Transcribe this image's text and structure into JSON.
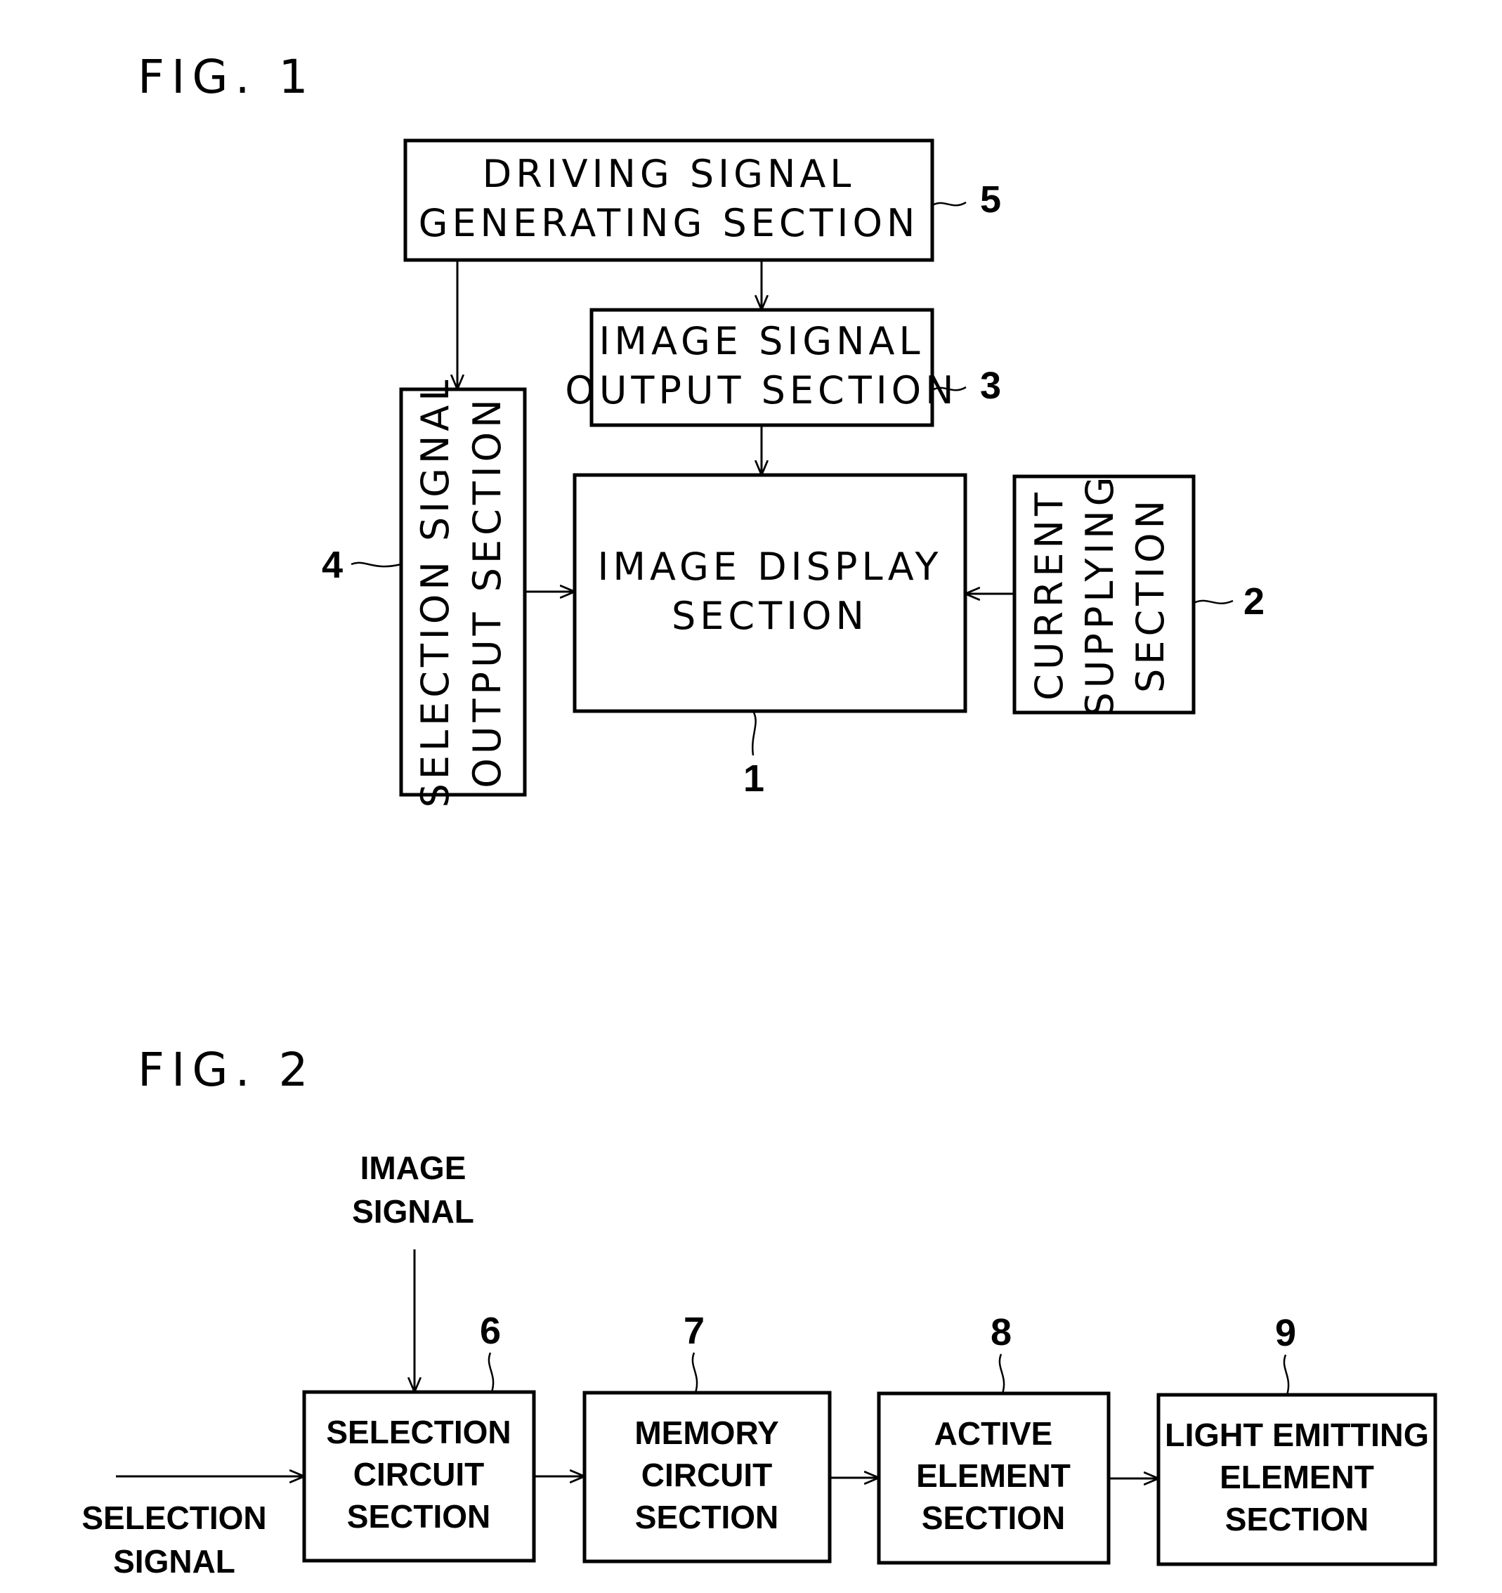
{
  "figures": [
    {
      "title": "FIG. 1",
      "blocks": {
        "driving_signal": {
          "ref": "5",
          "lines": [
            "DRIVING SIGNAL",
            "GENERATING SECTION"
          ]
        },
        "image_signal_output": {
          "ref": "3",
          "lines": [
            "IMAGE SIGNAL",
            "OUTPUT SECTION"
          ]
        },
        "selection_signal_output": {
          "ref": "4",
          "lines": [
            "SELECTION SIGNAL",
            "OUTPUT SECTION"
          ]
        },
        "image_display": {
          "ref": "1",
          "lines": [
            "IMAGE DISPLAY",
            "SECTION"
          ]
        },
        "current_supplying": {
          "ref": "2",
          "lines": [
            "CURRENT",
            "SUPPLYING",
            "SECTION"
          ]
        }
      },
      "connections": [
        {
          "from": "driving_signal",
          "to": "selection_signal_output"
        },
        {
          "from": "driving_signal",
          "to": "image_signal_output"
        },
        {
          "from": "image_signal_output",
          "to": "image_display"
        },
        {
          "from": "selection_signal_output",
          "to": "image_display"
        },
        {
          "from": "current_supplying",
          "to": "image_display"
        }
      ]
    },
    {
      "title": "FIG. 2",
      "inputs": {
        "image_signal": {
          "lines": [
            "IMAGE",
            "SIGNAL"
          ]
        },
        "selection_signal": {
          "lines": [
            "SELECTION",
            "SIGNAL"
          ]
        }
      },
      "blocks": {
        "selection_circuit": {
          "ref": "6",
          "lines": [
            "SELECTION",
            "CIRCUIT",
            "SECTION"
          ]
        },
        "memory_circuit": {
          "ref": "7",
          "lines": [
            "MEMORY",
            "CIRCUIT",
            "SECTION"
          ]
        },
        "active_element": {
          "ref": "8",
          "lines": [
            "ACTIVE",
            "ELEMENT",
            "SECTION"
          ]
        },
        "light_emitting_element": {
          "ref": "9",
          "lines": [
            "LIGHT EMITTING",
            "ELEMENT",
            "SECTION"
          ]
        }
      },
      "connections": [
        {
          "from": "image_signal",
          "to": "selection_circuit"
        },
        {
          "from": "selection_signal",
          "to": "selection_circuit"
        },
        {
          "from": "selection_circuit",
          "to": "memory_circuit"
        },
        {
          "from": "memory_circuit",
          "to": "active_element"
        },
        {
          "from": "active_element",
          "to": "light_emitting_element"
        }
      ]
    }
  ]
}
